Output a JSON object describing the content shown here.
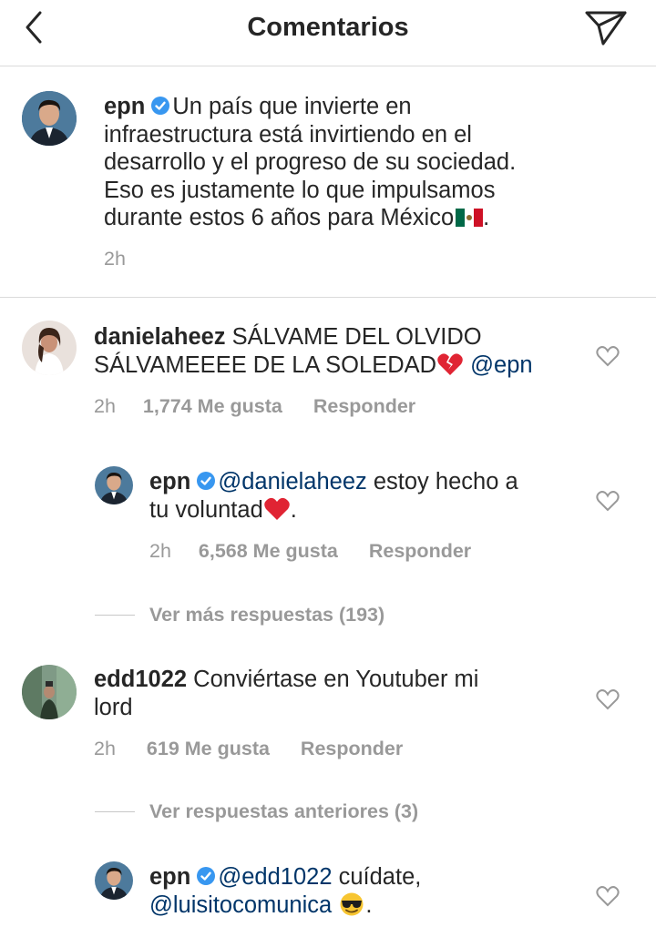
{
  "header": {
    "title": "Comentarios",
    "back_icon": "chevron-left-icon",
    "send_icon": "paper-plane-icon"
  },
  "caption": {
    "username": "epn",
    "verified": true,
    "lines": [
      "Un país que invierte en",
      "infraestructura está invirtiendo en el",
      "desarrollo y el progreso de su sociedad.",
      "Eso es justamente lo que impulsamos",
      "durante estos 6 años para México"
    ],
    "trailing": ".",
    "time": "2h"
  },
  "comments": [
    {
      "username": "danielaheez",
      "line1": "SÁLVAME DEL OLVIDO",
      "line2": "SÁLVAMEEEE DE LA SOLEDAD",
      "mention": "@epn",
      "time": "2h",
      "likes": "1,774 Me gusta",
      "reply": "Responder",
      "reply_thread": {
        "username": "epn",
        "verified": true,
        "mention": "@danielaheez",
        "line1_rest": "estoy hecho a",
        "line2": "tu voluntad",
        "trailing": ".",
        "time": "2h",
        "likes": "6,568 Me gusta",
        "reply": "Responder"
      },
      "more_replies": "Ver más respuestas (193)"
    },
    {
      "username": "edd1022",
      "line1": "Conviértase en Youtuber mi",
      "line2": "lord",
      "time": "2h",
      "likes": "619 Me gusta",
      "reply": "Responder",
      "previous_replies": "Ver respuestas anteriores (3)",
      "reply_thread": {
        "username": "epn",
        "verified": true,
        "mention": "@edd1022",
        "line1_rest": "cuídate,",
        "mention2": "@luisitocomunica",
        "trailing": "."
      }
    }
  ],
  "colors": {
    "text": "#262626",
    "meta": "#999999",
    "mention": "#003569",
    "verified": "#3897f0",
    "divider": "#dbdbdb"
  }
}
